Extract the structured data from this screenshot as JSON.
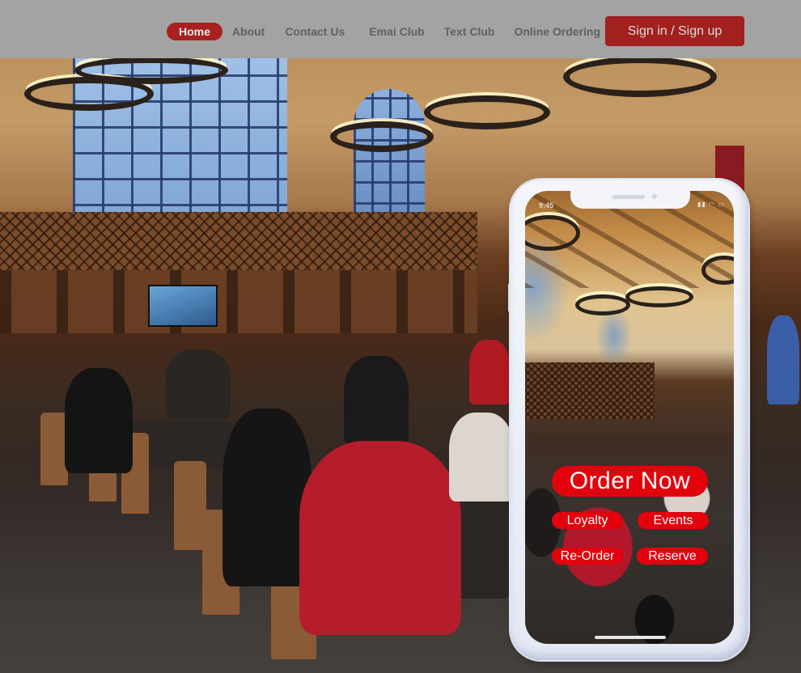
{
  "navbar": {
    "links": [
      {
        "label": "Home",
        "active": true
      },
      {
        "label": "About",
        "active": false
      },
      {
        "label": "Contact Us",
        "active": false
      },
      {
        "label": "Emai Club",
        "active": false
      },
      {
        "label": "Text Club",
        "active": false
      },
      {
        "label": "Online Ordering",
        "active": false
      }
    ],
    "signin_label": "Sign in / Sign up"
  },
  "phone": {
    "status_time": "9:45",
    "status_icons": "signal-icon wifi-icon battery-icon",
    "buttons": {
      "order_now": "Order Now",
      "loyalty": "Loyalty",
      "events": "Events",
      "reorder": "Re-Order",
      "reserve": "Reserve"
    }
  },
  "colors": {
    "navbar_bg": "#a3a3a3",
    "nav_text": "#616161",
    "active_pill": "#a8211f",
    "signin_bg": "#a2201e",
    "app_button_red": "#e3000d",
    "phone_frame": "#eef1f8"
  }
}
